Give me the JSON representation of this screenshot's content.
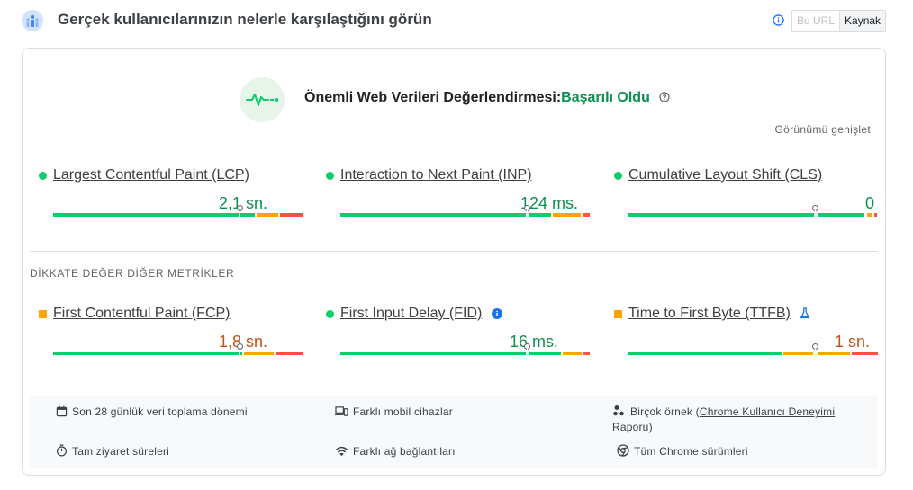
{
  "header": {
    "title": "Gerçek kullanıcılarınızın nelerle karşılaştığını görün",
    "toggle": {
      "off": "Bu URL",
      "on": "Kaynak"
    }
  },
  "assessment": {
    "prefix": "Önemli Web Verileri Değerlendirmesi:",
    "status": "Başarılı Oldu",
    "expand_label": "Görünümü genişlet"
  },
  "core_metrics": [
    {
      "label": "Largest Contentful Paint (LCP)",
      "value": "2,1 sn.",
      "rating": "good"
    },
    {
      "label": "Interaction to Next Paint (INP)",
      "value": "124 ms.",
      "rating": "good"
    },
    {
      "label": "Cumulative Layout Shift (CLS)",
      "value": "0",
      "rating": "good"
    }
  ],
  "other_section_title": "DİKKATE DEĞER DİĞER METRİKLER",
  "other_metrics": [
    {
      "label": "First Contentful Paint (FCP)",
      "value": "1,8 sn.",
      "rating": "average"
    },
    {
      "label": "First Input Delay (FID)",
      "value": "16 ms.",
      "rating": "good"
    },
    {
      "label": "Time to First Byte (TTFB)",
      "value": "1 sn.",
      "rating": "average"
    }
  ],
  "footer": {
    "period": "Son 28 günlük veri toplama dönemi",
    "devices": "Farklı mobil cihazlar",
    "samples_prefix": "Birçok örnek (",
    "samples_link": "Chrome Kullanıcı Deneyimi Raporu",
    "samples_suffix": ")",
    "duration": "Tam ziyaret süreleri",
    "network": "Farklı ağ bağlantıları",
    "chrome": "Tüm Chrome sürümleri"
  },
  "colors": {
    "good": "#0cce6b",
    "average": "#ffa400",
    "poor": "#ff4e42",
    "good_text": "#0d904f",
    "average_text": "#c5521a"
  }
}
